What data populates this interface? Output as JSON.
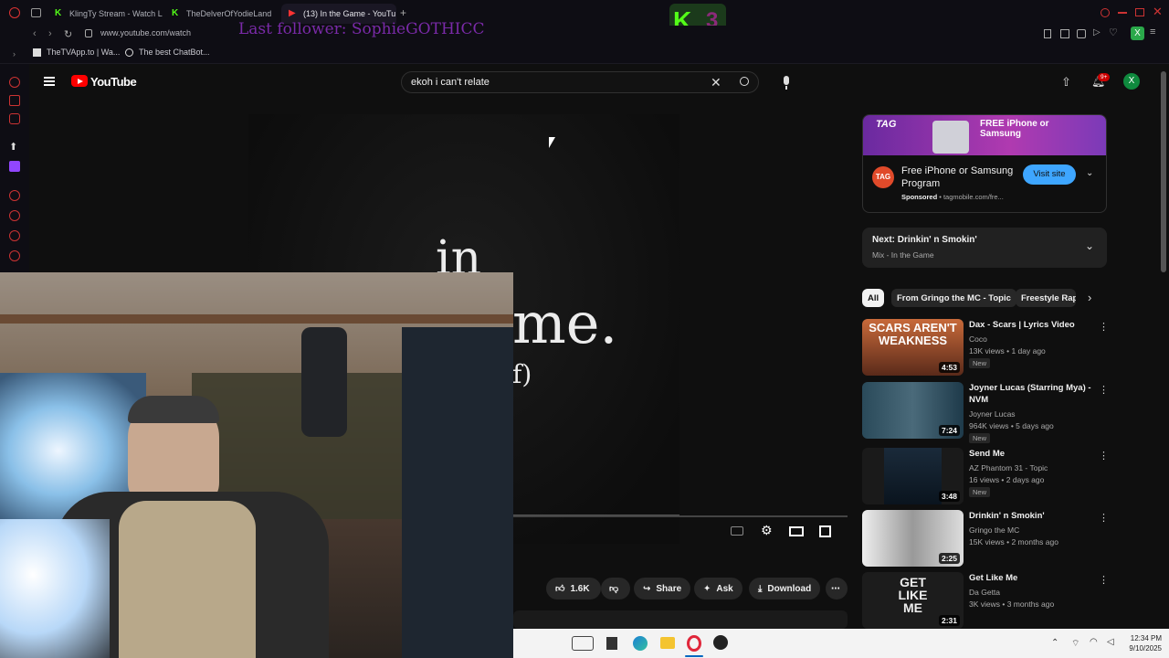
{
  "browser": {
    "tabs": [
      {
        "title": "KlingTy Stream - Watch L",
        "active": false
      },
      {
        "title": "TheDelverOfYodieLand",
        "active": false
      },
      {
        "title": "(13) In the Game - YouTu",
        "active": true
      }
    ],
    "url": "www.youtube.com/watch",
    "bookmarks": [
      "TheTVApp.to | Wa...",
      "The best ChatBot..."
    ],
    "profile_initial": "X"
  },
  "overlay": {
    "last_follower": "Last follower: SophieGOTHICC"
  },
  "youtube": {
    "logo_text": "YouTube",
    "search_query": "ekoh i can't relate",
    "notifications_count": "9+",
    "avatar_initial": "X"
  },
  "player": {
    "title_line1": "in",
    "title_line2": "me.",
    "title_line3": "f)"
  },
  "actions": {
    "likes": "1.6K",
    "share": "Share",
    "ask": "Ask",
    "download": "Download"
  },
  "ad": {
    "brand_badge": "TAG",
    "banner_text": "FREE iPhone or Samsung",
    "title": "Free iPhone or Samsung Program",
    "sponsored": "Sponsored",
    "domain": "tagmobile.com/fre...",
    "cta": "Visit site"
  },
  "next": {
    "label": "Next: Drinkin' n Smokin'",
    "sub": "Mix - In the Game"
  },
  "chips": [
    "All",
    "From Gringo the MC - Topic",
    "Freestyle Rap"
  ],
  "recommendations": [
    {
      "title": "Dax - Scars | Lyrics Video",
      "channel": "Coco",
      "meta": "13K views • 1 day ago",
      "new": "New",
      "duration": "4:53",
      "thumb_color": "#6b3a2c"
    },
    {
      "title": "Joyner Lucas (Starring Mya) - NVM",
      "channel": "Joyner Lucas",
      "meta": "964K views • 5 days ago",
      "new": "New",
      "duration": "7:24",
      "thumb_color": "#2c4a5e"
    },
    {
      "title": "Send Me",
      "channel": "AZ Phantom 31 - Topic",
      "meta": "16 views • 2 days ago",
      "new": "New",
      "duration": "3:48",
      "thumb_color": "#1d2a36"
    },
    {
      "title": "Drinkin' n Smokin'",
      "channel": "Gringo the MC",
      "meta": "15K views • 2 months ago",
      "new": "",
      "duration": "2:25",
      "thumb_color": "#8a8a86"
    },
    {
      "title": "Get Like Me",
      "channel": "Da Getta",
      "meta": "3K views • 3 months ago",
      "new": "",
      "duration": "2:31",
      "thumb_color": "#3a3a3a"
    }
  ],
  "thumb_texts": [
    "SCARS AREN'T WEAKNESS",
    "",
    "",
    "",
    "GET LIKE ME"
  ],
  "system": {
    "time": "12:34 PM",
    "date": "9/10/2025"
  },
  "colors": {
    "accent_blue": "#3ea6ff",
    "youtube_red": "#ff0000",
    "twitch_purple": "#9146ff"
  }
}
